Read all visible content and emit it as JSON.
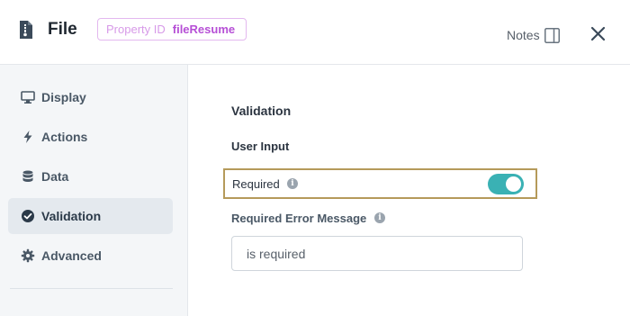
{
  "header": {
    "title": "File",
    "property_id_label": "Property ID",
    "property_id_value": "fileResume",
    "notes_label": "Notes"
  },
  "sidebar": {
    "items": [
      {
        "label": "Display",
        "icon": "monitor-icon"
      },
      {
        "label": "Actions",
        "icon": "lightning-icon"
      },
      {
        "label": "Data",
        "icon": "database-icon"
      },
      {
        "label": "Validation",
        "icon": "check-circle-icon",
        "active": true
      },
      {
        "label": "Advanced",
        "icon": "gear-icon"
      }
    ]
  },
  "main": {
    "section_title": "Validation",
    "subsection_title": "User Input",
    "required_label": "Required",
    "required_enabled": true,
    "error_message_label": "Required Error Message",
    "error_message_value": "is required"
  },
  "colors": {
    "toggle_on": "#3ab1b4",
    "badge_border": "#e3b8ef",
    "badge_text": "#b64fd6",
    "highlight_border": "#b59a5a"
  }
}
